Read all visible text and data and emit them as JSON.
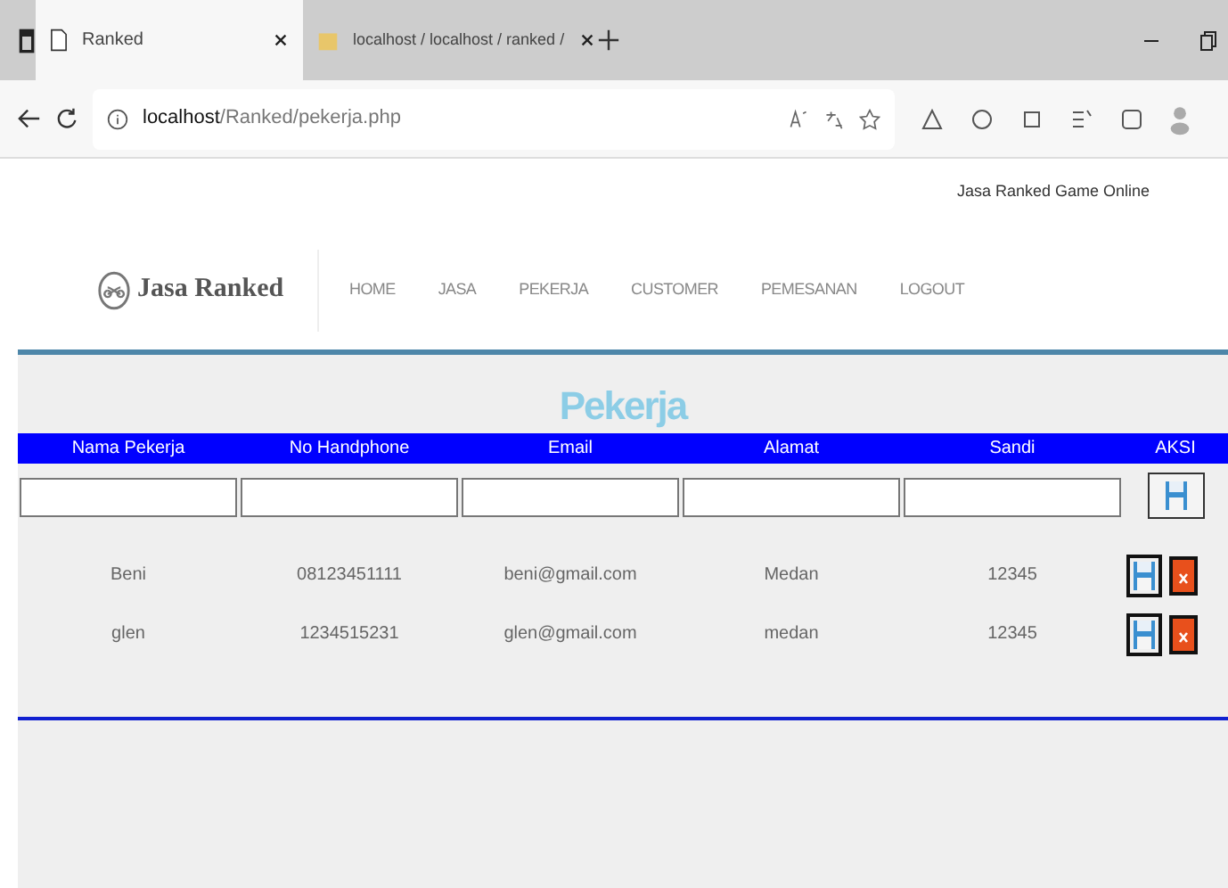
{
  "browser": {
    "tabs": [
      {
        "title": "Ranked",
        "selected": true
      },
      {
        "title": "localhost / localhost / ranked /",
        "selected": false
      }
    ],
    "address": {
      "host": "localhost",
      "path": "/Ranked/pekerja.php"
    }
  },
  "site": {
    "tagline": "Jasa Ranked Game Online",
    "brand": "Jasa Ranked",
    "nav": [
      "HOME",
      "JASA",
      "PEKERJA",
      "CUSTOMER",
      "PEMESANAN",
      "LOGOUT"
    ],
    "page_title": "Pekerja",
    "table": {
      "columns": [
        "Nama Pekerja",
        "No Handphone",
        "Email",
        "Alamat",
        "Sandi",
        "AKSI"
      ],
      "rows": [
        [
          "Beni",
          "08123451111",
          "beni@gmail.com",
          "Medan",
          "12345"
        ],
        [
          "glen",
          "1234515231",
          "glen@gmail.com",
          "medan",
          "12345"
        ]
      ]
    }
  }
}
